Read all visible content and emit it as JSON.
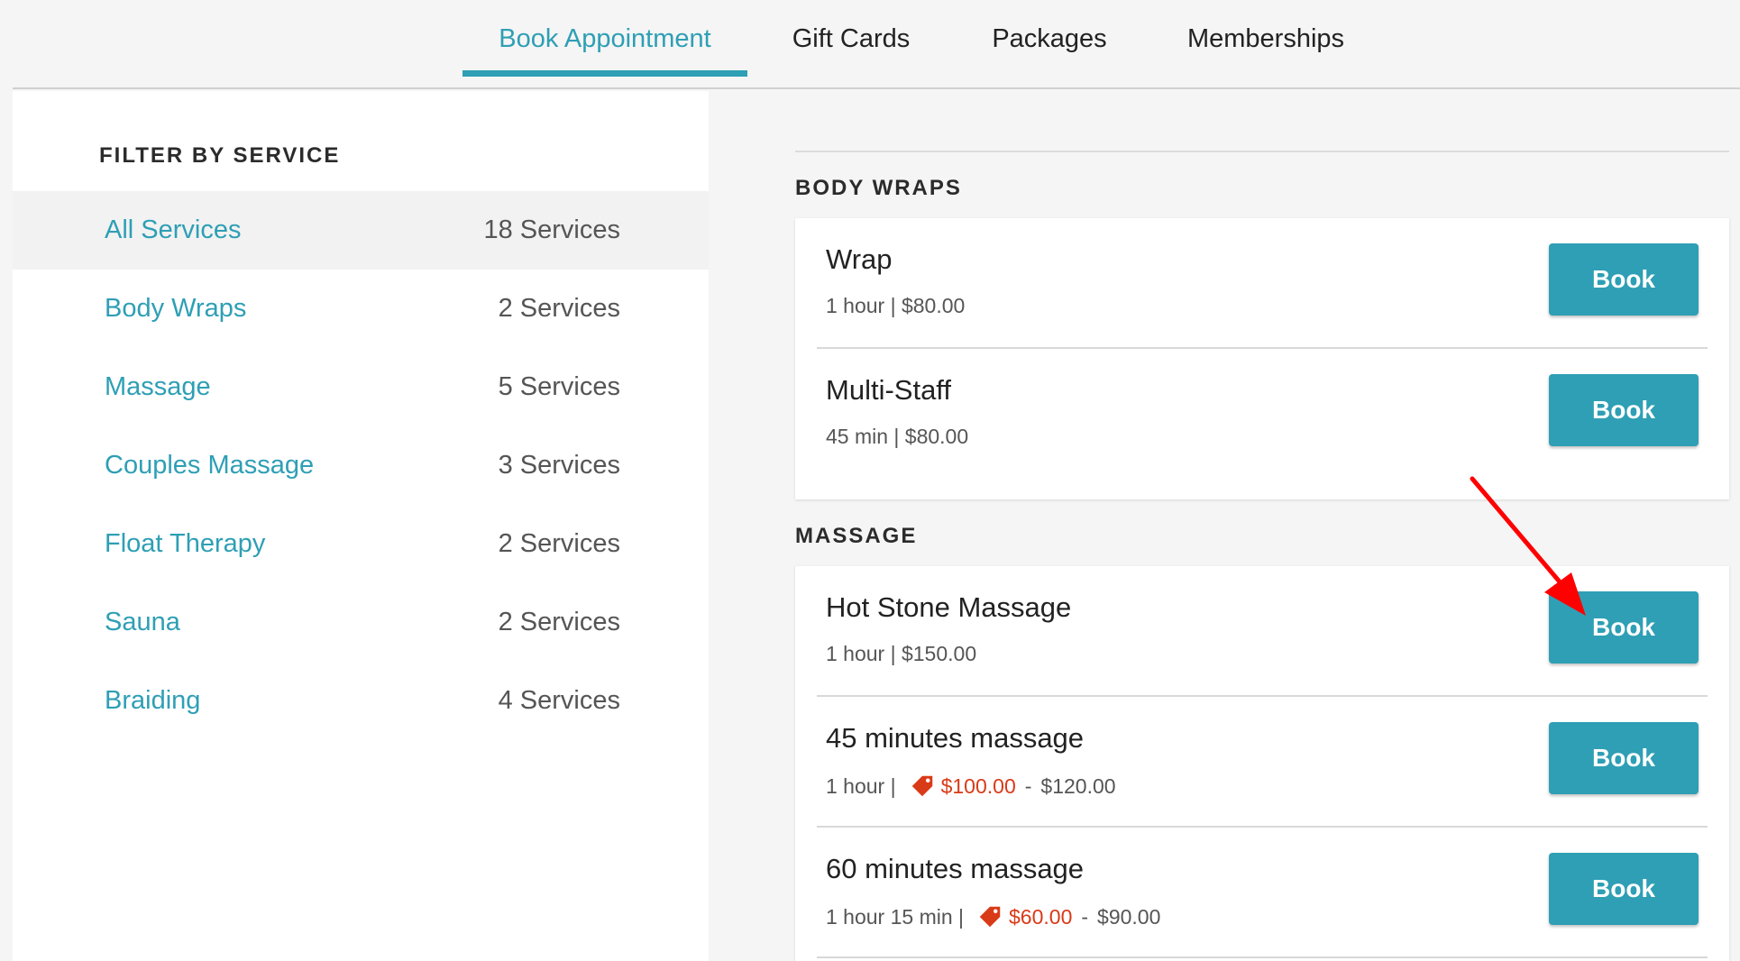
{
  "nav": {
    "tabs": [
      {
        "label": "Book Appointment",
        "active": true
      },
      {
        "label": "Gift Cards",
        "active": false
      },
      {
        "label": "Packages",
        "active": false
      },
      {
        "label": "Memberships",
        "active": false
      }
    ]
  },
  "sidebar": {
    "title": "FILTER BY SERVICE",
    "items": [
      {
        "label": "All Services",
        "count": "18 Services",
        "selected": true
      },
      {
        "label": "Body Wraps",
        "count": "2 Services"
      },
      {
        "label": "Massage",
        "count": "5 Services"
      },
      {
        "label": "Couples Massage",
        "count": "3 Services"
      },
      {
        "label": "Float Therapy",
        "count": "2 Services"
      },
      {
        "label": "Sauna",
        "count": "2 Services"
      },
      {
        "label": "Braiding",
        "count": "4 Services"
      }
    ]
  },
  "sections": [
    {
      "title": "BODY WRAPS",
      "services": [
        {
          "name": "Wrap",
          "detail": "1 hour | $80.00",
          "button": "Book"
        },
        {
          "name": "Multi-Staff",
          "detail": "45 min | $80.00",
          "button": "Book"
        }
      ]
    },
    {
      "title": "MASSAGE",
      "services": [
        {
          "name": "Hot Stone Massage",
          "detail": "1 hour | $150.00",
          "button": "Book"
        },
        {
          "name": "45 minutes massage",
          "detail_prefix": "1 hour |",
          "sale_price": "$100.00",
          "dash": "-",
          "regular_price": "$120.00",
          "button": "Book"
        },
        {
          "name": "60 minutes massage",
          "detail_prefix": "1 hour 15 min |",
          "sale_price": "$60.00",
          "dash": "-",
          "regular_price": "$90.00",
          "button": "Book"
        }
      ]
    }
  ],
  "colors": {
    "accent": "#2e9fb5",
    "sale": "#d93a17",
    "annotation_arrow": "#ff0000"
  }
}
